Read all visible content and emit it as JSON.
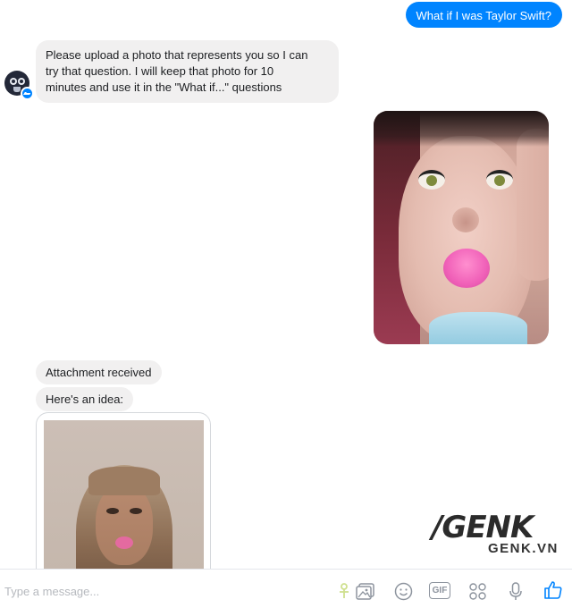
{
  "conversation": {
    "user_message": "What if I was Taylor Swift?",
    "bot_message_lines": [
      "Please upload a photo that represents you so I can",
      "try that question. I will keep that photo for 10",
      "minutes and use it in the \"What if...\" questions"
    ],
    "attachment_status": "Attachment received",
    "idea_intro": "Here's an idea:"
  },
  "watermark": {
    "logo": "/GENK",
    "url": "GENK.VN"
  },
  "composer": {
    "placeholder": "Type a message...",
    "icons": [
      "attachment-emoji-icon",
      "photo-icon",
      "emoji-icon",
      "gif-icon",
      "games-icon",
      "microphone-icon",
      "like-icon"
    ],
    "gif_label": "GIF"
  },
  "colors": {
    "outgoing_bubble": "#0084ff",
    "incoming_bubble": "#f1f0f0",
    "accent": "#0084ff"
  }
}
